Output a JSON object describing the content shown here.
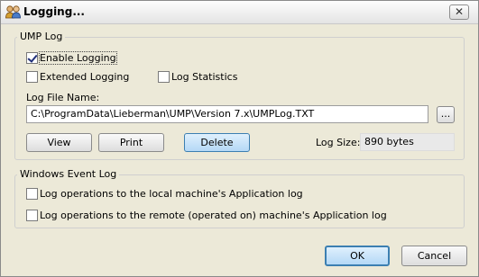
{
  "window": {
    "title": "Logging..."
  },
  "ump_log": {
    "legend": "UMP Log",
    "enable_logging": {
      "label": "Enable Logging",
      "checked": true
    },
    "extended_logging": {
      "label": "Extended Logging",
      "checked": false
    },
    "log_statistics": {
      "label": "Log Statistics",
      "checked": false
    },
    "file_name_label": "Log File Name:",
    "file_name_value": "C:\\ProgramData\\Lieberman\\UMP\\Version 7.x\\UMPLog.TXT",
    "browse_label": "...",
    "view_label": "View",
    "print_label": "Print",
    "delete_label": "Delete",
    "log_size_label": "Log Size:",
    "log_size_value": "890 bytes"
  },
  "event_log": {
    "legend": "Windows Event Log",
    "local_option": {
      "label": "Log operations to the local machine's Application log",
      "checked": false
    },
    "remote_option": {
      "label": "Log operations to the remote (operated on) machine's Application log",
      "checked": false
    }
  },
  "footer": {
    "ok_label": "OK",
    "cancel_label": "Cancel"
  }
}
